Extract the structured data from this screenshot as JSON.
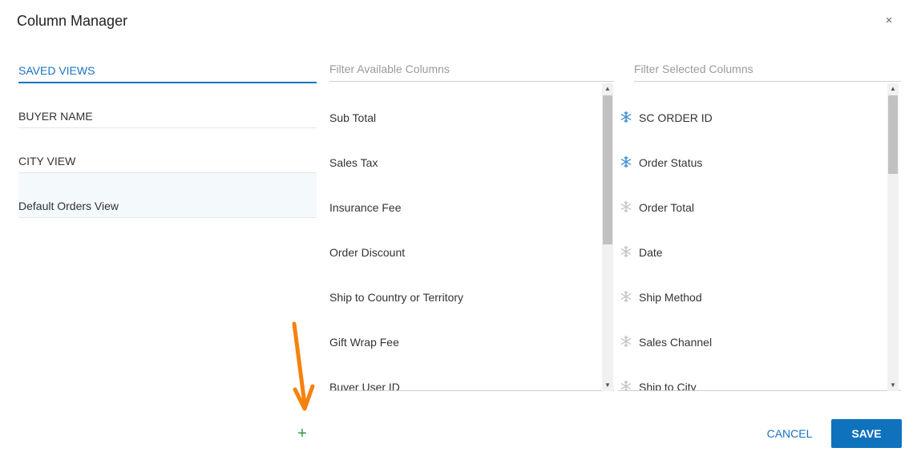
{
  "dialog": {
    "title": "Column Manager",
    "close_label": "×"
  },
  "saved_views": {
    "header": "SAVED VIEWS",
    "items": [
      {
        "label": "BUYER NAME"
      },
      {
        "label": "CITY VIEW"
      },
      {
        "label": "Default Orders View"
      }
    ],
    "selected_index": 2
  },
  "available": {
    "filter_placeholder": "Filter Available Columns",
    "items": [
      {
        "label": "Sub Total"
      },
      {
        "label": "Sales Tax"
      },
      {
        "label": "Insurance Fee"
      },
      {
        "label": "Order Discount"
      },
      {
        "label": "Ship to Country or Territory"
      },
      {
        "label": "Gift Wrap Fee"
      },
      {
        "label": "Buyer User ID"
      }
    ]
  },
  "selected": {
    "filter_placeholder": "Filter Selected Columns",
    "items": [
      {
        "label": "SC ORDER ID",
        "frozen": true
      },
      {
        "label": "Order Status",
        "frozen": true
      },
      {
        "label": "Order Total",
        "frozen": false
      },
      {
        "label": "Date",
        "frozen": false
      },
      {
        "label": "Ship Method",
        "frozen": false
      },
      {
        "label": "Sales Channel",
        "frozen": false
      },
      {
        "label": "Ship to City",
        "frozen": false
      }
    ]
  },
  "footer": {
    "add_label": "+",
    "cancel_label": "CANCEL",
    "save_label": "SAVE"
  },
  "colors": {
    "accent": "#1a73c0",
    "save_button": "#0f72bd",
    "add": "#2e9a3b",
    "frozen_icon": "#3d8fd1",
    "unfrozen_icon": "#c4c4c4",
    "annotation_arrow": "#f5820d"
  },
  "icons": {
    "close": "close-icon",
    "freeze": "snowflake-icon",
    "add": "plus-icon",
    "scroll_up": "triangle-up-icon",
    "scroll_down": "triangle-down-icon"
  }
}
